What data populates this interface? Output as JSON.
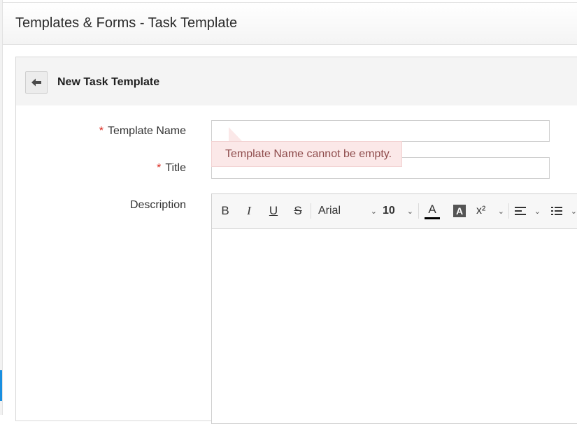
{
  "page": {
    "title": "Templates & Forms - Task Template"
  },
  "panel": {
    "title": "New Task Template"
  },
  "form": {
    "required_marker": "*",
    "template_name": {
      "label": "Template Name",
      "value": "",
      "placeholder": ""
    },
    "title": {
      "label": "Title",
      "value": "",
      "placeholder": ""
    },
    "description": {
      "label": "Description"
    },
    "error_message": "Template Name cannot be empty."
  },
  "editor": {
    "toolbar": {
      "bold": "B",
      "italic": "I",
      "underline": "U",
      "strikethrough": "S",
      "font_family": "Arial",
      "font_size": "10",
      "font_color": "A",
      "highlight": "A",
      "superscript": "x²"
    },
    "content": ""
  },
  "colors": {
    "required": "#d9261c",
    "error_bg": "#fbe8e8",
    "error_text": "#8e4b4b",
    "accent": "#1a8fe0"
  }
}
